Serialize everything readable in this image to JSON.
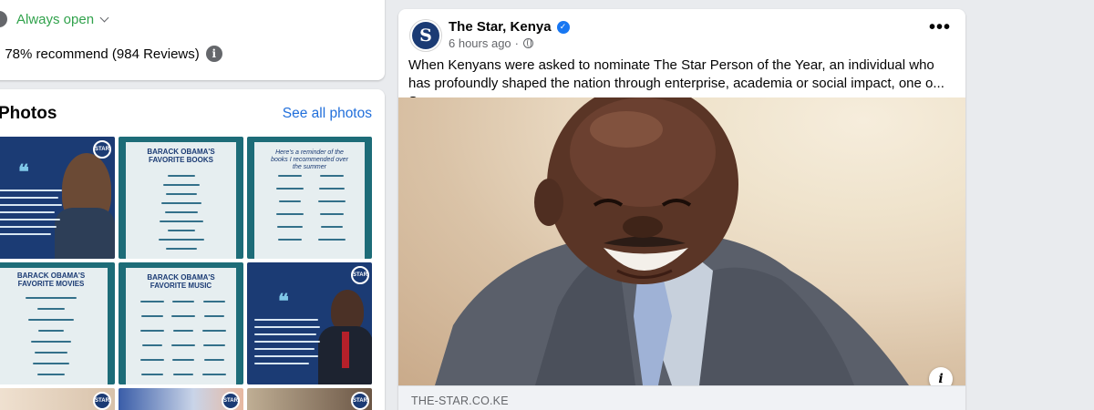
{
  "info": {
    "hours": "Always open",
    "recommend": "78% recommend (984 Reviews)"
  },
  "photos": {
    "title": "Photos",
    "see_all": "See all photos",
    "thumbs": [
      {
        "head": ""
      },
      {
        "head": "BARACK OBAMA'S FAVORITE BOOKS"
      },
      {
        "head": "Here's a reminder of the books I recommended over the summer"
      },
      {
        "head": "BARACK OBAMA'S FAVORITE MOVIES"
      },
      {
        "head": "BARACK OBAMA'S FAVORITE MUSIC"
      },
      {
        "head": ""
      }
    ],
    "badge": "STAR"
  },
  "post": {
    "page_name": "The Star, Kenya",
    "avatar_letter": "S",
    "time": "6 hours ago",
    "separator": "·",
    "text": "When Kenyans were asked to nominate The Star Person of the Year, an individual who has profoundly shaped the nation through enterprise, academia or social impact, one o...",
    "see_more": "See more",
    "link_domain": "THE-STAR.CO.KE",
    "more_icon": "•••"
  },
  "colors": {
    "link": "#216fdb",
    "open": "#31a24c",
    "brand_navy": "#1b3b74",
    "verified": "#1877f2"
  }
}
